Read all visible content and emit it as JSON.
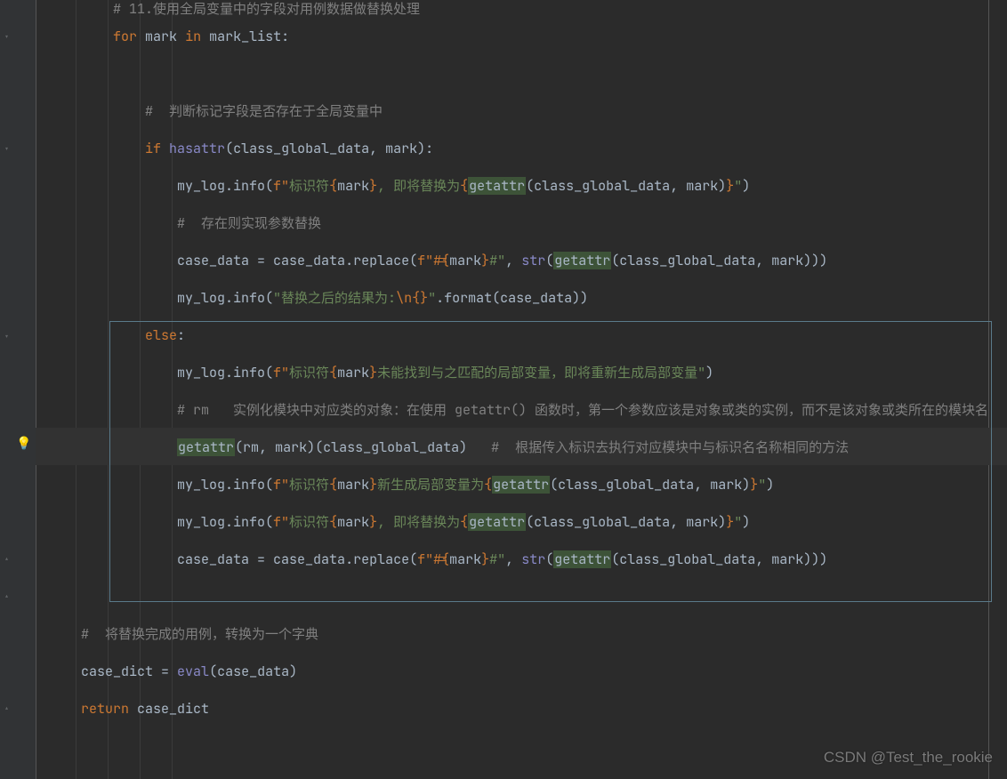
{
  "watermark": "CSDN @Test_the_rookie",
  "code": {
    "c1": "# 11.使用全局变量中的字段对用例数据做替换处理",
    "for": "for",
    "mark_v": "mark",
    "in": "in",
    "mark_list": "mark_list:",
    "c2": "#  判断标记字段是否存在于全局变量中",
    "if": "if",
    "hasattr": "hasattr",
    "cgd": "class_global_data",
    "mylog": "my_log.info(",
    "fpfx": "f\"",
    "s_biaoshi": "标识符",
    "s_huanwei": ", 即将替换为",
    "getattr": "getattr",
    "c3": "#  存在则实现参数替换",
    "casedata": "case_data",
    "replace": ".replace(",
    "str": "str",
    "s_result": "替换之后的结果为:",
    "nl": "\\n",
    "fmt": ".format(case_data))",
    "else": "else",
    "s_nomatch": "未能找到与之匹配的局部变量，即将重新生成局部变量",
    "c_rm": "# rm   实例化模块中对应类的对象：在使用 getattr() 函数时，第一个参数应该是对象或类的实例，而不是该对象或类所在的模块名",
    "rm": "rm",
    "c_method": "#  根据传入标识去执行对应模块中与标识名名称相同的方法",
    "s_newvar": "新生成局部变量为",
    "c_final": "#  将替换完成的用例，转换为一个字典",
    "casedict": "case_dict",
    "eval": "eval",
    "return": "return"
  }
}
